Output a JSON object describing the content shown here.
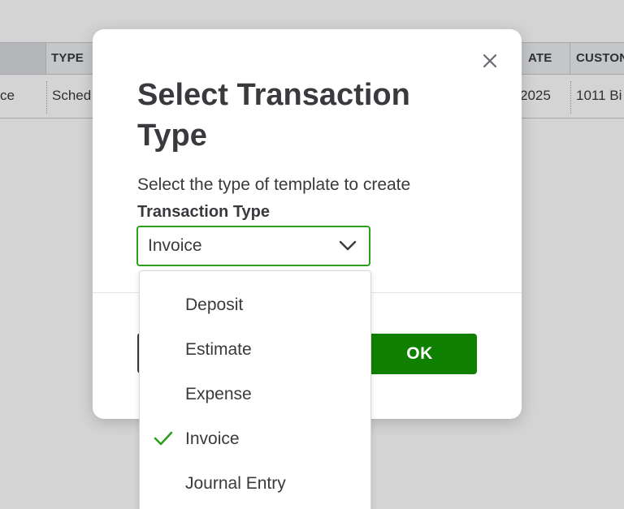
{
  "background_table": {
    "headers": [
      "TYPE",
      "ATE",
      "CUSTON"
    ],
    "row": [
      "ce",
      "Sched",
      "2025",
      "1011 Bi"
    ]
  },
  "modal": {
    "title": "Select Transaction Type",
    "subtitle": "Select the type of template to create",
    "field_label": "Transaction Type",
    "selected_value": "Invoice",
    "ok_label": "OK",
    "close_icon": "close-icon",
    "chevron_icon": "chevron-down-icon"
  },
  "dropdown": {
    "items": [
      {
        "label": "Deposit",
        "selected": false
      },
      {
        "label": "Estimate",
        "selected": false
      },
      {
        "label": "Expense",
        "selected": false
      },
      {
        "label": "Invoice",
        "selected": true
      },
      {
        "label": "Journal Entry",
        "selected": false
      }
    ],
    "check_icon": "checkmark-icon"
  },
  "colors": {
    "accent_green": "#2ca01c",
    "primary_button": "#108000",
    "text": "#393a3d"
  }
}
